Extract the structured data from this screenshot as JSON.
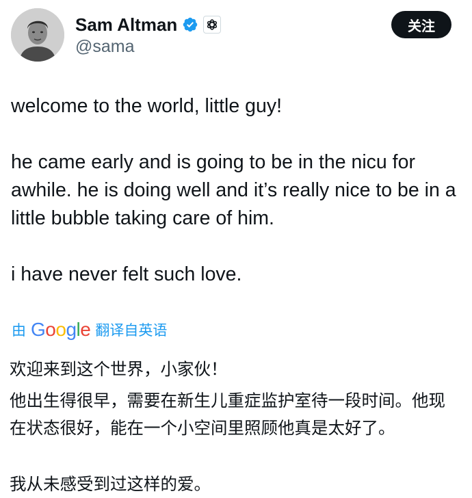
{
  "author": {
    "display_name": "Sam Altman",
    "handle": "@sama",
    "verified_icon": "verified-badge-icon",
    "affiliate_icon": "openai-logo-icon",
    "brand_color": "#1d9bf0"
  },
  "follow_button": {
    "label": "关注"
  },
  "tweet": {
    "paragraphs": [
      "welcome to the world, little guy!",
      "he came early and is going to be in the nicu for awhile. he is doing well and it’s really nice to be in a little bubble taking care of him.",
      "i have never felt such love."
    ]
  },
  "translation_bar": {
    "prefix": "由",
    "provider": "Google",
    "suffix": "翻译自英语",
    "link_color": "#1d9bf0"
  },
  "translation": {
    "paragraphs": [
      "欢迎来到这个世界，小家伙！",
      "他出生得很早，需要在新生儿重症监护室待一段时间。他现在状态很好，能在一个小空间里照顾他真是太好了。",
      "我从未感受到过这样的爱。"
    ]
  }
}
